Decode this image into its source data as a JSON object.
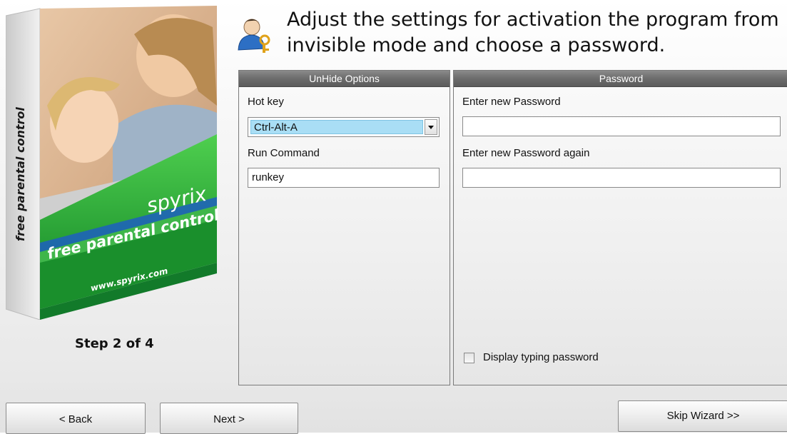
{
  "wizard": {
    "step_text": "Step 2 of 4",
    "heading": "Adjust the settings for activation the program from invisible mode and choose a password."
  },
  "product_box": {
    "spine_text": "free parental control",
    "brand": "spyrix",
    "tagline": "free parental control",
    "website": "www.spyrix.com",
    "colors": {
      "green": "#2fae3b",
      "dark_green": "#127a2a",
      "blue": "#1d5fbf",
      "spine": "#d8d8d8"
    }
  },
  "unhide_panel": {
    "title": "UnHide Options",
    "hotkey_label": "Hot key",
    "hotkey_value": "Ctrl-Alt-A",
    "run_command_label": "Run Command",
    "run_command_value": "runkey"
  },
  "password_panel": {
    "title": "Password",
    "new_password_label": "Enter new Password",
    "new_password_value": "",
    "confirm_password_label": "Enter new Password again",
    "confirm_password_value": "",
    "display_typing_label": "Display typing password",
    "display_typing_checked": false
  },
  "buttons": {
    "back": "< Back",
    "next": "Next >",
    "skip": "Skip Wizard >>"
  },
  "icons": {
    "header_icon": "user-key-icon",
    "dropdown_arrow": "chevron-down-icon"
  }
}
